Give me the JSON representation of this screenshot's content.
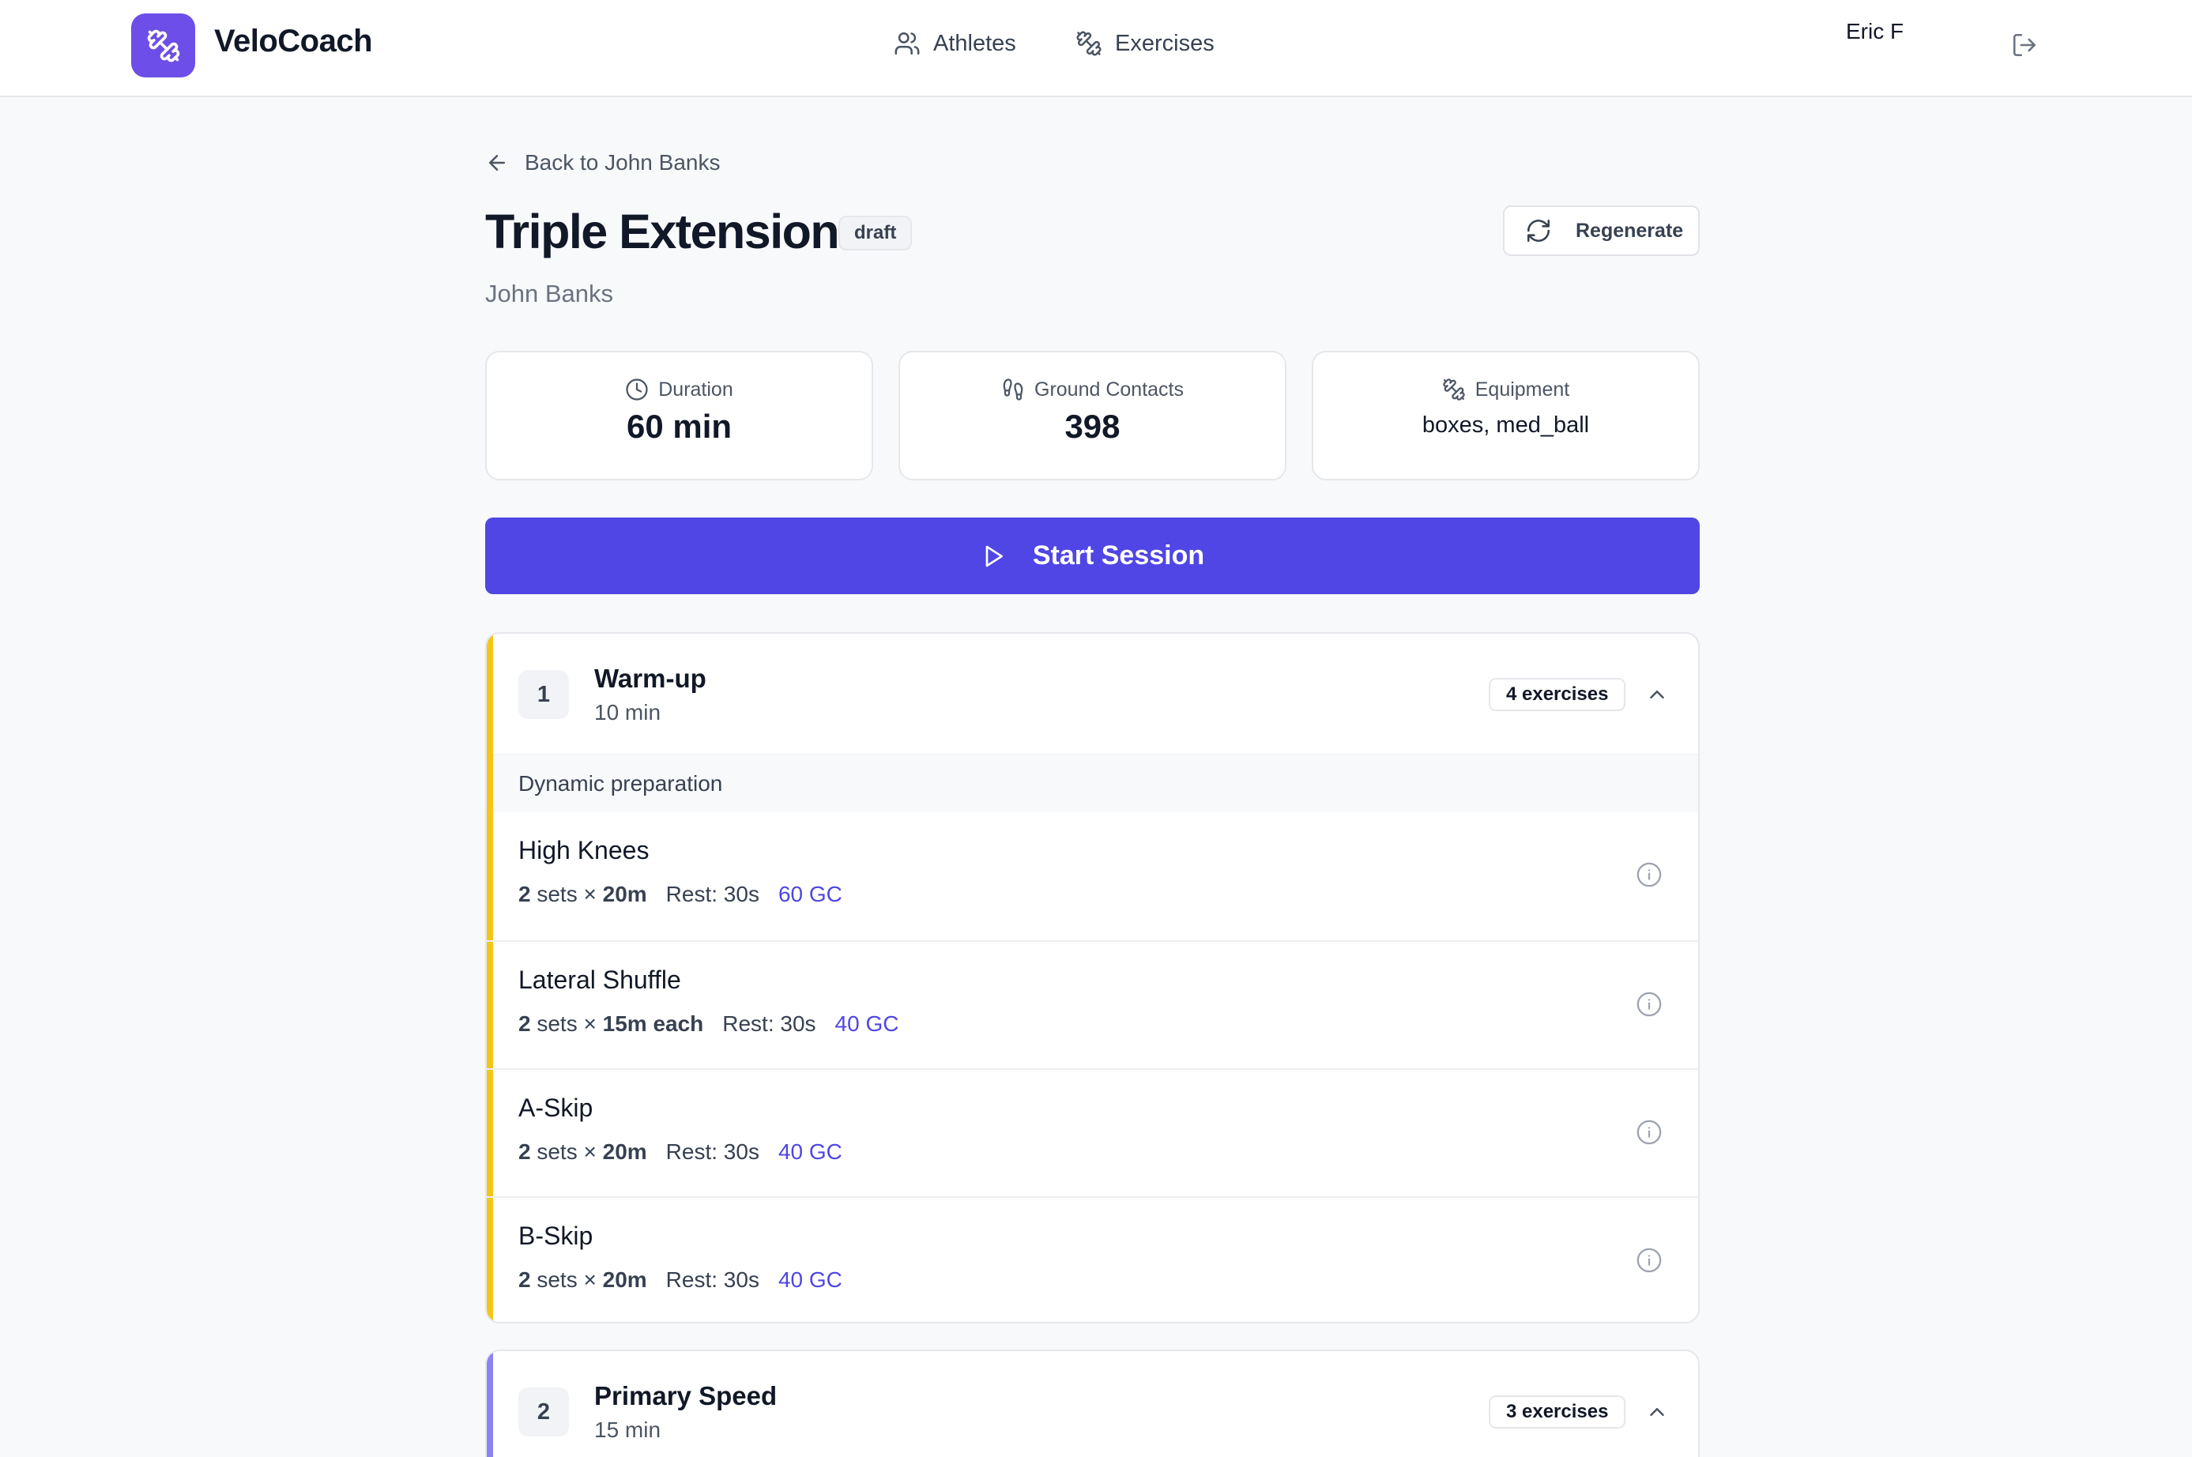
{
  "header": {
    "brand": "VeloCoach",
    "nav": [
      {
        "label": "Athletes",
        "icon": "users-icon"
      },
      {
        "label": "Exercises",
        "icon": "dumbbell-icon"
      }
    ],
    "user_name": "Eric F",
    "logout_icon": "logout-icon"
  },
  "page": {
    "back_label": "Back to John Banks",
    "title": "Triple Extension",
    "status_badge": "draft",
    "athlete": "John Banks",
    "regenerate_label": "Regenerate",
    "start_label": "Start Session"
  },
  "stats": {
    "duration": {
      "label": "Duration",
      "value": "60 min"
    },
    "ground_contacts": {
      "label": "Ground Contacts",
      "value": "398"
    },
    "equipment": {
      "label": "Equipment",
      "value": "boxes, med_ball"
    }
  },
  "colors": {
    "brand": "#6d4ee8",
    "primary": "#4f46e5",
    "warmup_accent": "#f5c518",
    "speed_accent": "#8b84f0"
  },
  "sections": [
    {
      "number": "1",
      "title": "Warm-up",
      "duration": "10 min",
      "count": "4 exercises",
      "description": "Dynamic preparation",
      "exercises": [
        {
          "name": "High Knees",
          "sets": "2",
          "sets_word": "sets ×",
          "amount": "20m",
          "rest": "Rest: 30s",
          "gc": "60 GC"
        },
        {
          "name": "Lateral Shuffle",
          "sets": "2",
          "sets_word": "sets ×",
          "amount": "15m each",
          "rest": "Rest: 30s",
          "gc": "40 GC"
        },
        {
          "name": "A-Skip",
          "sets": "2",
          "sets_word": "sets ×",
          "amount": "20m",
          "rest": "Rest: 30s",
          "gc": "40 GC"
        },
        {
          "name": "B-Skip",
          "sets": "2",
          "sets_word": "sets ×",
          "amount": "20m",
          "rest": "Rest: 30s",
          "gc": "40 GC"
        }
      ]
    },
    {
      "number": "2",
      "title": "Primary Speed",
      "duration": "15 min",
      "count": "3 exercises"
    }
  ]
}
